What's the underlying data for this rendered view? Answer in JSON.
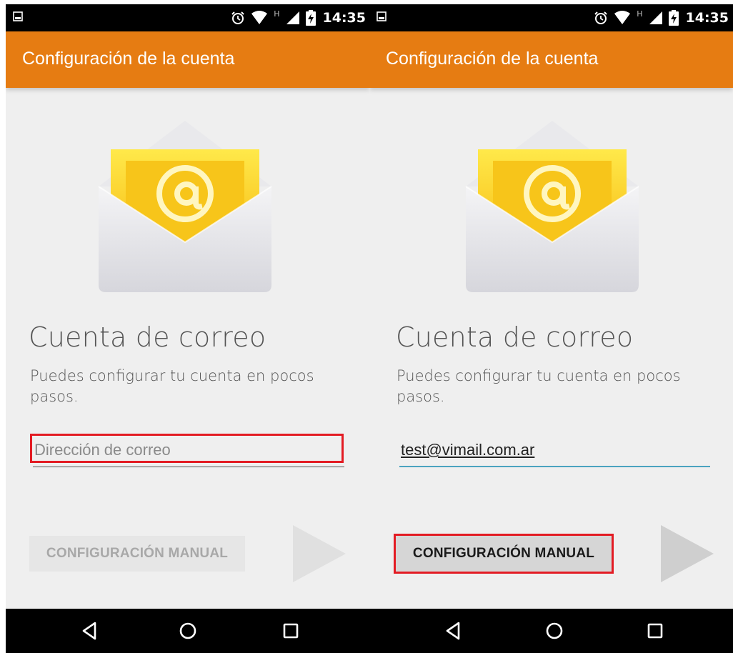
{
  "status_bar": {
    "time": "14:35",
    "network_type": "H"
  },
  "app_bar": {
    "title": "Configuración de la cuenta"
  },
  "screens": [
    {
      "heading": "Cuenta de correo",
      "subtext": "Puedes configurar tu cuenta en pocos pasos.",
      "email_field": {
        "value": "",
        "placeholder": "Dirección de correo",
        "focused": false
      },
      "manual_button": {
        "label": "CONFIGURACIÓN MANUAL",
        "enabled": false
      },
      "next_button": {
        "enabled": false
      }
    },
    {
      "heading": "Cuenta de correo",
      "subtext": "Puedes configurar tu cuenta en pocos pasos.",
      "email_field": {
        "value": "test@vimail.com.ar",
        "placeholder": "",
        "focused": true
      },
      "manual_button": {
        "label": "CONFIGURACIÓN MANUAL",
        "enabled": true
      },
      "next_button": {
        "enabled": false
      }
    }
  ],
  "icons": {
    "envelope": "mail-envelope-at-icon",
    "status": [
      "notification-image-icon",
      "alarm-icon",
      "wifi-icon",
      "cell-signal-icon",
      "battery-charging-icon"
    ],
    "nav": [
      "back-icon",
      "home-icon",
      "recents-icon"
    ],
    "next": "next-arrow-icon"
  },
  "colors": {
    "app_bar": "#e67c12",
    "highlight": "#e31b23",
    "field_focus_underline": "#4aa3c0",
    "screen_background": "#efefef"
  }
}
